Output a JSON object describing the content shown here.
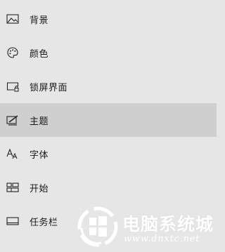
{
  "nav": {
    "items": [
      {
        "label": "背景",
        "icon": "picture-icon",
        "selected": false
      },
      {
        "label": "颜色",
        "icon": "palette-icon",
        "selected": false
      },
      {
        "label": "锁屏界面",
        "icon": "lock-screen-icon",
        "selected": false
      },
      {
        "label": "主题",
        "icon": "theme-brush-icon",
        "selected": true
      },
      {
        "label": "字体",
        "icon": "font-icon",
        "selected": false
      },
      {
        "label": "开始",
        "icon": "start-layout-icon",
        "selected": false
      },
      {
        "label": "任务栏",
        "icon": "taskbar-icon",
        "selected": false
      }
    ]
  },
  "watermark": {
    "title": "电脑系统城",
    "url": "www.dnxtc.net",
    "color": "#ffffff"
  },
  "colors": {
    "background": "#e6e6e6",
    "selected": "#cfcfcf",
    "text": "#1a1a1a"
  }
}
